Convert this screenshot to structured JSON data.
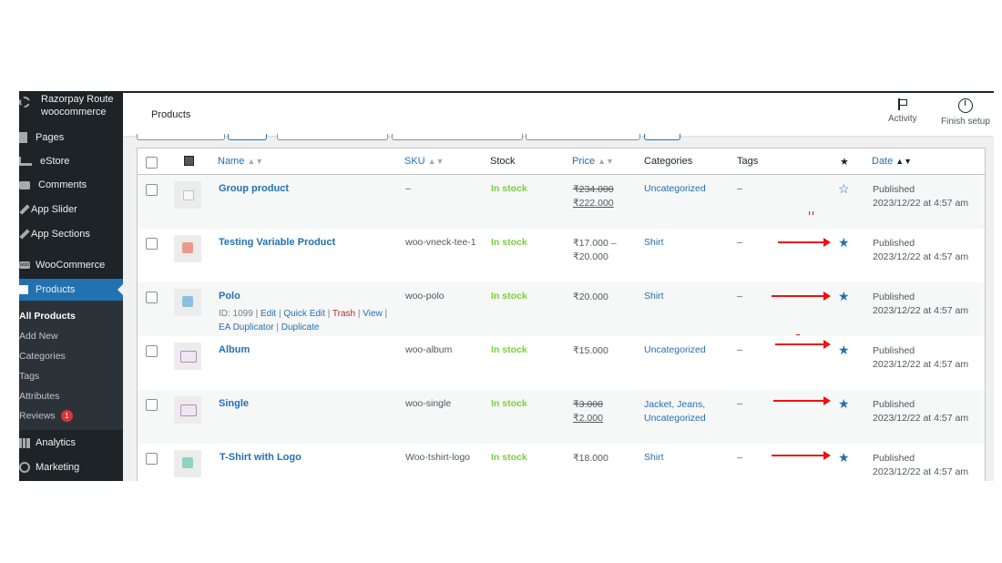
{
  "sidebar": {
    "site_name": "Razorpay Route woocommerce",
    "items": [
      {
        "label": "Pages",
        "icon": "pages-icon"
      },
      {
        "label": "eStore",
        "icon": "cart-icon"
      },
      {
        "label": "Comments",
        "icon": "comments-icon"
      },
      {
        "label": "App Slider",
        "icon": "pin-icon"
      },
      {
        "label": "App Sections",
        "icon": "pin-icon"
      },
      {
        "label": "WooCommerce",
        "icon": "woocommerce-icon"
      },
      {
        "label": "Products",
        "icon": "products-icon"
      },
      {
        "label": "Analytics",
        "icon": "analytics-icon"
      },
      {
        "label": "Marketing",
        "icon": "marketing-icon"
      }
    ],
    "submenu": [
      {
        "label": "All Products"
      },
      {
        "label": "Add New"
      },
      {
        "label": "Categories"
      },
      {
        "label": "Tags"
      },
      {
        "label": "Attributes"
      },
      {
        "label": "Reviews",
        "badge": "1"
      }
    ],
    "woo_icon_text": "woo"
  },
  "header": {
    "title": "Products",
    "activity_label": "Activity",
    "finish_setup_label": "Finish setup"
  },
  "table": {
    "columns": {
      "name": "Name",
      "sku": "SKU",
      "stock": "Stock",
      "price": "Price",
      "categories": "Categories",
      "tags": "Tags",
      "featured": "★",
      "date": "Date"
    },
    "rows": [
      {
        "name": "Group product",
        "sku": "–",
        "stock": "In stock",
        "price_old": "₹234.000",
        "price_new": "₹222.000",
        "categories": "Uncategorized",
        "tags": "–",
        "featured": "☆",
        "status": "Published",
        "date": "2023/12/22 at 4:57 am"
      },
      {
        "name": "Testing Variable Product",
        "sku": "woo-vneck-tee-1",
        "stock": "In stock",
        "price_line1": "₹17.000 –",
        "price_line2": "₹20.000",
        "categories": "Shirt",
        "tags": "–",
        "featured": "★",
        "status": "Published",
        "date": "2023/12/22 at 4:57 am"
      },
      {
        "name": "Polo",
        "id_text": "ID: 1099 |",
        "actions": {
          "edit": "Edit",
          "quick_edit": "Quick Edit",
          "trash": "Trash",
          "view": "View",
          "ea_duplicator": "EA Duplicator",
          "duplicate": "Duplicate"
        },
        "sku": "woo-polo",
        "stock": "In stock",
        "price": "₹20.000",
        "categories": "Shirt",
        "tags": "–",
        "featured": "★",
        "status": "Published",
        "date": "2023/12/22 at 4:57 am"
      },
      {
        "name": "Album",
        "sku": "woo-album",
        "stock": "In stock",
        "price": "₹15.000",
        "categories": "Uncategorized",
        "tags": "–",
        "featured": "★",
        "status": "Published",
        "date": "2023/12/22 at 4:57 am"
      },
      {
        "name": "Single",
        "sku": "woo-single",
        "stock": "In stock",
        "price_old": "₹3.000",
        "price_new": "₹2.000",
        "categories_line1": "Jacket, Jeans,",
        "categories_line2": "Uncategorized",
        "tags": "–",
        "featured": "★",
        "status": "Published",
        "date": "2023/12/22 at 4:57 am"
      },
      {
        "name": "T-Shirt with Logo",
        "sku": "Woo-tshirt-logo",
        "stock": "In stock",
        "price": "₹18.000",
        "categories": "Shirt",
        "tags": "–",
        "featured": "★",
        "status": "Published",
        "date": "2023/12/22 at 4:57 am"
      }
    ]
  },
  "colors": {
    "admin_bar": "#1d2327",
    "accent": "#2271b1",
    "in_stock": "#7ad03a",
    "annotation_arrow": "#ee1111"
  }
}
